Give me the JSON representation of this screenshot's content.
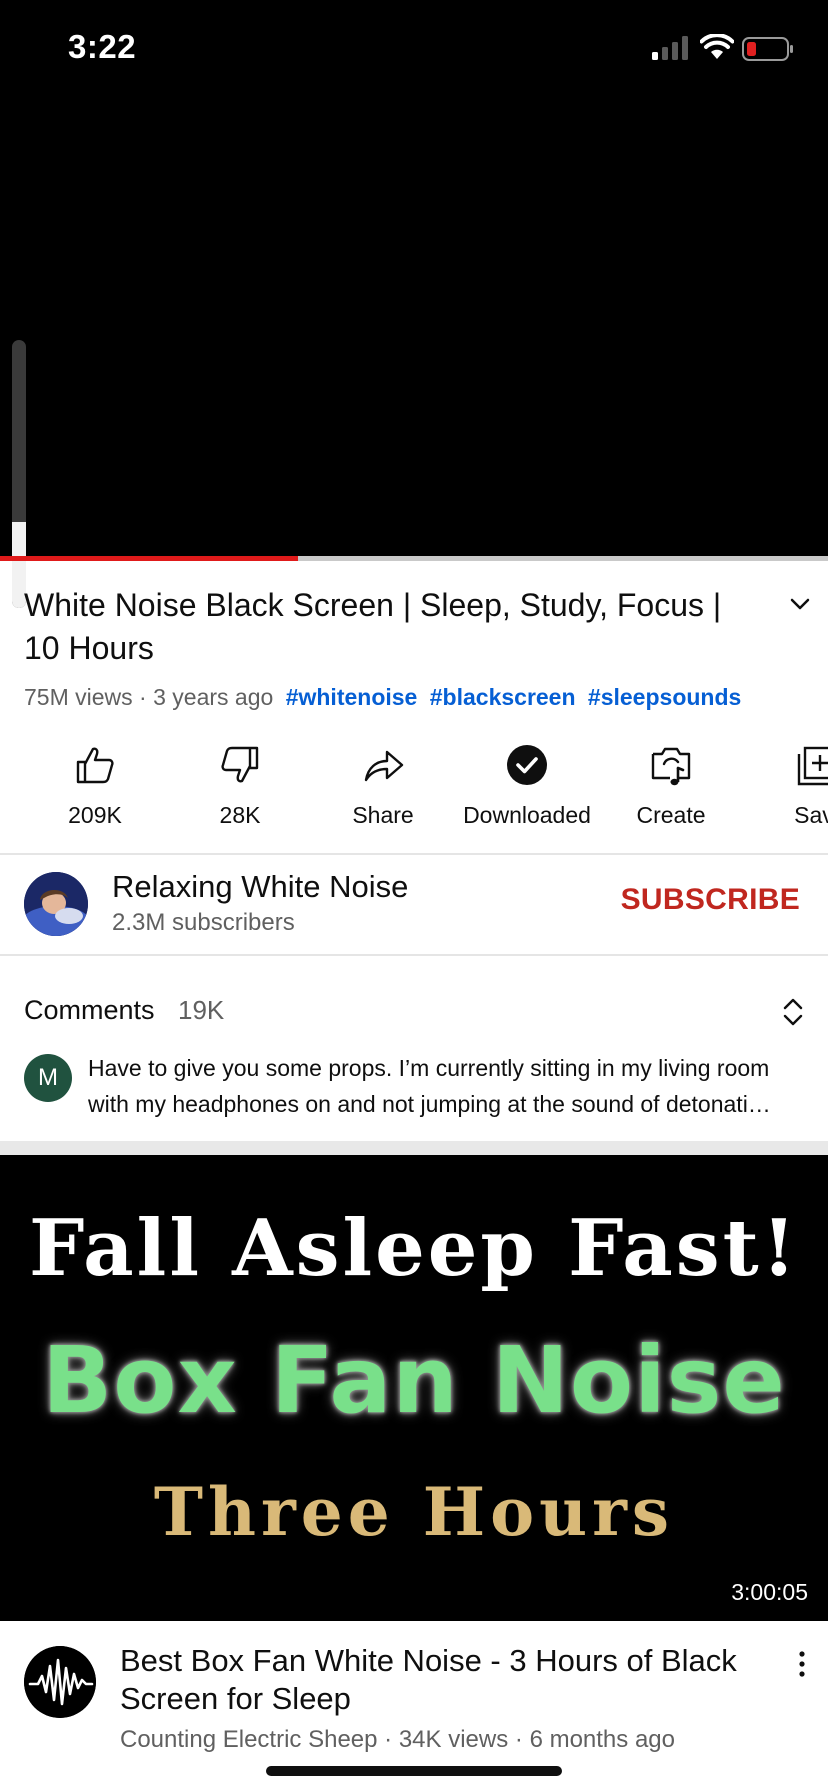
{
  "status_bar": {
    "time": "3:22",
    "battery_color": "#e02020"
  },
  "player": {
    "volume_level": 0.32,
    "progress": 0.36
  },
  "video": {
    "title": "White Noise Black Screen | Sleep, Study, Focus | 10 Hours",
    "views": "75M views",
    "age": "3 years ago",
    "hashtags": [
      "#whitenoise",
      "#blackscreen",
      "#sleepsounds"
    ]
  },
  "actions": [
    {
      "label": "209K",
      "icon": "thumbs-up-icon"
    },
    {
      "label": "28K",
      "icon": "thumbs-down-icon"
    },
    {
      "label": "Share",
      "icon": "share-icon"
    },
    {
      "label": "Downloaded",
      "icon": "downloaded-check-icon"
    },
    {
      "label": "Create",
      "icon": "create-icon"
    },
    {
      "label": "Sav",
      "icon": "save-playlist-icon"
    }
  ],
  "channel": {
    "name": "Relaxing White Noise",
    "subscribers": "2.3M subscribers",
    "subscribe_label": "SUBSCRIBE"
  },
  "comments": {
    "title": "Comments",
    "count": "19K",
    "first_avatar_letter": "M",
    "first_text": "Have to give you some props. I’m currently sitting in my living room with my headphones on and not jumping at the sound of detonati…"
  },
  "next_video": {
    "thumbnail_text": [
      "Fall Asleep Fast!",
      "Box Fan Noise",
      "Three Hours"
    ],
    "duration": "3:00:05",
    "title": "Best Box Fan White Noise - 3 Hours of Black Screen for Sleep",
    "channel": "Counting Electric Sheep",
    "views": "34K views",
    "age": "6 months ago"
  },
  "colors": {
    "accent_red": "#e01a1a",
    "subscribe_red": "#c0271f",
    "hashtag_blue": "#065fd4",
    "thumb_green": "#79e08a",
    "thumb_gold": "#d9b978"
  }
}
